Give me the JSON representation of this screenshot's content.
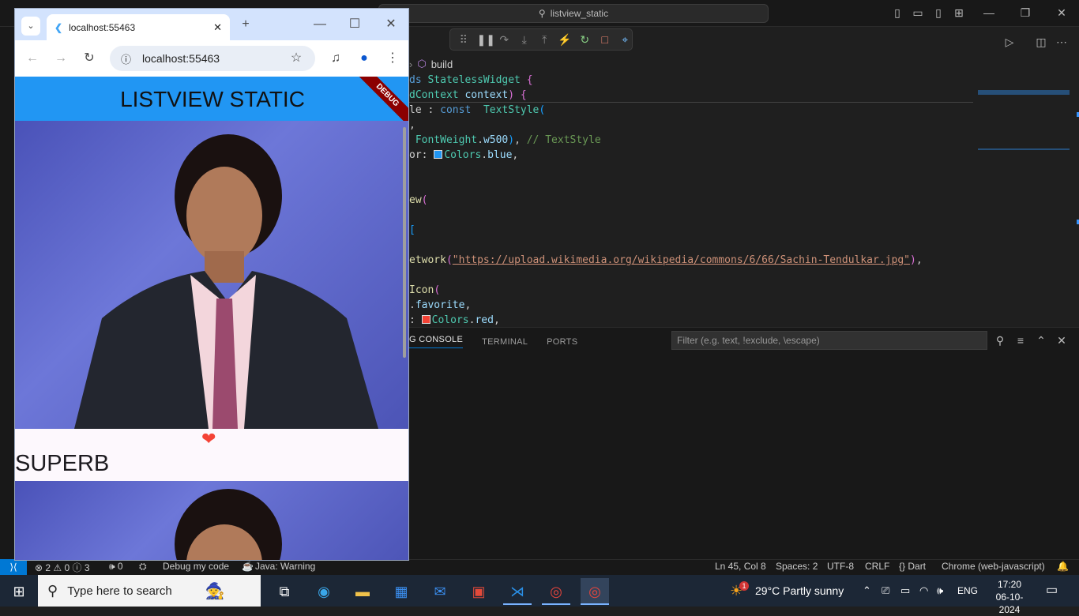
{
  "vscode": {
    "search": "listview_static",
    "breadcrumb": "build",
    "code_lines": [
      {
        "parts": [
          [
            "kw",
            "ds "
          ],
          [
            "ty",
            "StatelessWidget "
          ],
          [
            "br",
            "{"
          ]
        ]
      },
      {
        "parts": [
          [
            "ty",
            "dContext "
          ],
          [
            "pr",
            "context"
          ],
          [
            "br",
            ") {"
          ]
        ]
      },
      {
        "parts": [
          [
            "pl",
            "le : "
          ],
          [
            "kw",
            "const  "
          ],
          [
            "ty",
            "TextStyle"
          ],
          [
            "br2",
            "("
          ]
        ]
      },
      {
        "parts": [
          [
            "pl",
            ","
          ]
        ]
      },
      {
        "parts": [
          [
            "pl",
            " "
          ],
          [
            "ty",
            "FontWeight"
          ],
          [
            "pl",
            "."
          ],
          [
            "pr",
            "w500"
          ],
          [
            "br2",
            ")"
          ],
          [
            "pl",
            ", "
          ],
          [
            "cm",
            "// TextStyle"
          ]
        ]
      },
      {
        "parts": [
          [
            "pl",
            "or: "
          ],
          [
            "sw1",
            ""
          ],
          [
            "ty",
            "Colors"
          ],
          [
            "pl",
            "."
          ],
          [
            "pr",
            "blue"
          ],
          [
            "pl",
            ","
          ]
        ]
      },
      {
        "parts": [
          [
            "pl",
            ""
          ]
        ]
      },
      {
        "parts": [
          [
            "pl",
            ""
          ]
        ]
      },
      {
        "parts": [
          [
            "fn",
            "ew"
          ],
          [
            "br",
            "("
          ]
        ]
      },
      {
        "parts": [
          [
            "pl",
            ""
          ]
        ]
      },
      {
        "parts": [
          [
            "br2",
            "["
          ]
        ]
      },
      {
        "parts": [
          [
            "pl",
            ""
          ]
        ]
      },
      {
        "parts": [
          [
            "fn",
            "etwork"
          ],
          [
            "br",
            "("
          ],
          [
            "st",
            "\"https://upload.wikimedia.org/wikipedia/commons/6/66/Sachin-Tendulkar.jpg\""
          ],
          [
            "br",
            ")"
          ],
          [
            "pl",
            ","
          ]
        ]
      },
      {
        "parts": [
          [
            "pl",
            ""
          ]
        ]
      },
      {
        "parts": [
          [
            "fn",
            "Icon"
          ],
          [
            "br",
            "("
          ]
        ]
      },
      {
        "parts": [
          [
            "pl",
            "."
          ],
          [
            "pr",
            "favorite"
          ],
          [
            "pl",
            ","
          ]
        ]
      },
      {
        "parts": [
          [
            "pl",
            ": "
          ],
          [
            "sw2",
            ""
          ],
          [
            "ty",
            "Colors"
          ],
          [
            "pl",
            "."
          ],
          [
            "pr",
            "red"
          ],
          [
            "pl",
            ","
          ]
        ]
      }
    ],
    "swatch_blue": "#2196f3",
    "swatch_red": "#f44336",
    "panel_tabs": [
      "G CONSOLE",
      "TERMINAL",
      "PORTS"
    ],
    "filter_placeholder": "Filter (e.g. text, !exclude, \\escape)",
    "status": {
      "problems": "⊗ 2 ⚠ 0 ⓘ 3",
      "ports": "🕪 0",
      "debug": "Debug my code",
      "java": "Java: Warning",
      "position": "Ln 45, Col 8",
      "spaces": "Spaces: 2",
      "encoding": "UTF-8",
      "eol": "CRLF",
      "language": "{} Dart",
      "device": "Chrome (web-javascript)"
    }
  },
  "chrome": {
    "tab_title": "localhost:55463",
    "url": "localhost:55463",
    "app_title": "LISTVIEW STATIC",
    "debug_label": "DEBUG",
    "item_text": "SUPERB",
    "heart_color": "#f44336"
  },
  "taskbar": {
    "search_placeholder": "Type here to search",
    "weather": "29°C  Partly sunny",
    "lang": "ENG",
    "time": "17:20",
    "date": "06-10-2024",
    "weather_badge": "1"
  }
}
